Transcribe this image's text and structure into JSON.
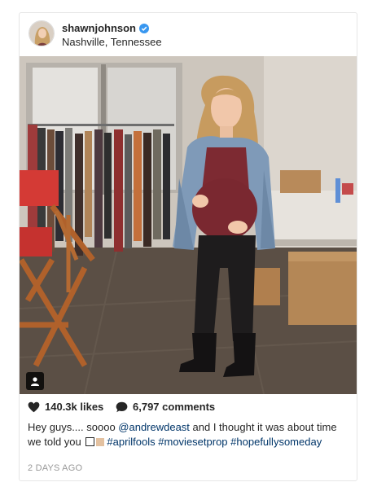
{
  "post": {
    "username": "shawnjohnson",
    "location": "Nashville, Tennessee",
    "likes": "140.3k likes",
    "comments": "6,797 comments",
    "caption": {
      "lead": "Hey guys.... soooo ",
      "mention": "@andrewdeast",
      "middle": " and I thought it was about time we told you ",
      "tag1": "#aprilfools",
      "tag2": "#moviesetprop",
      "tag3": "#hopefullysomeday"
    },
    "time": "2 DAYS AGO"
  },
  "icons": {
    "verified": "verified-badge-icon",
    "like": "heart-icon",
    "comment": "comment-bubble-icon",
    "tagged": "user-tag-icon"
  },
  "colors": {
    "verified": "#3897f0",
    "link": "#003569",
    "muted": "#999999"
  }
}
